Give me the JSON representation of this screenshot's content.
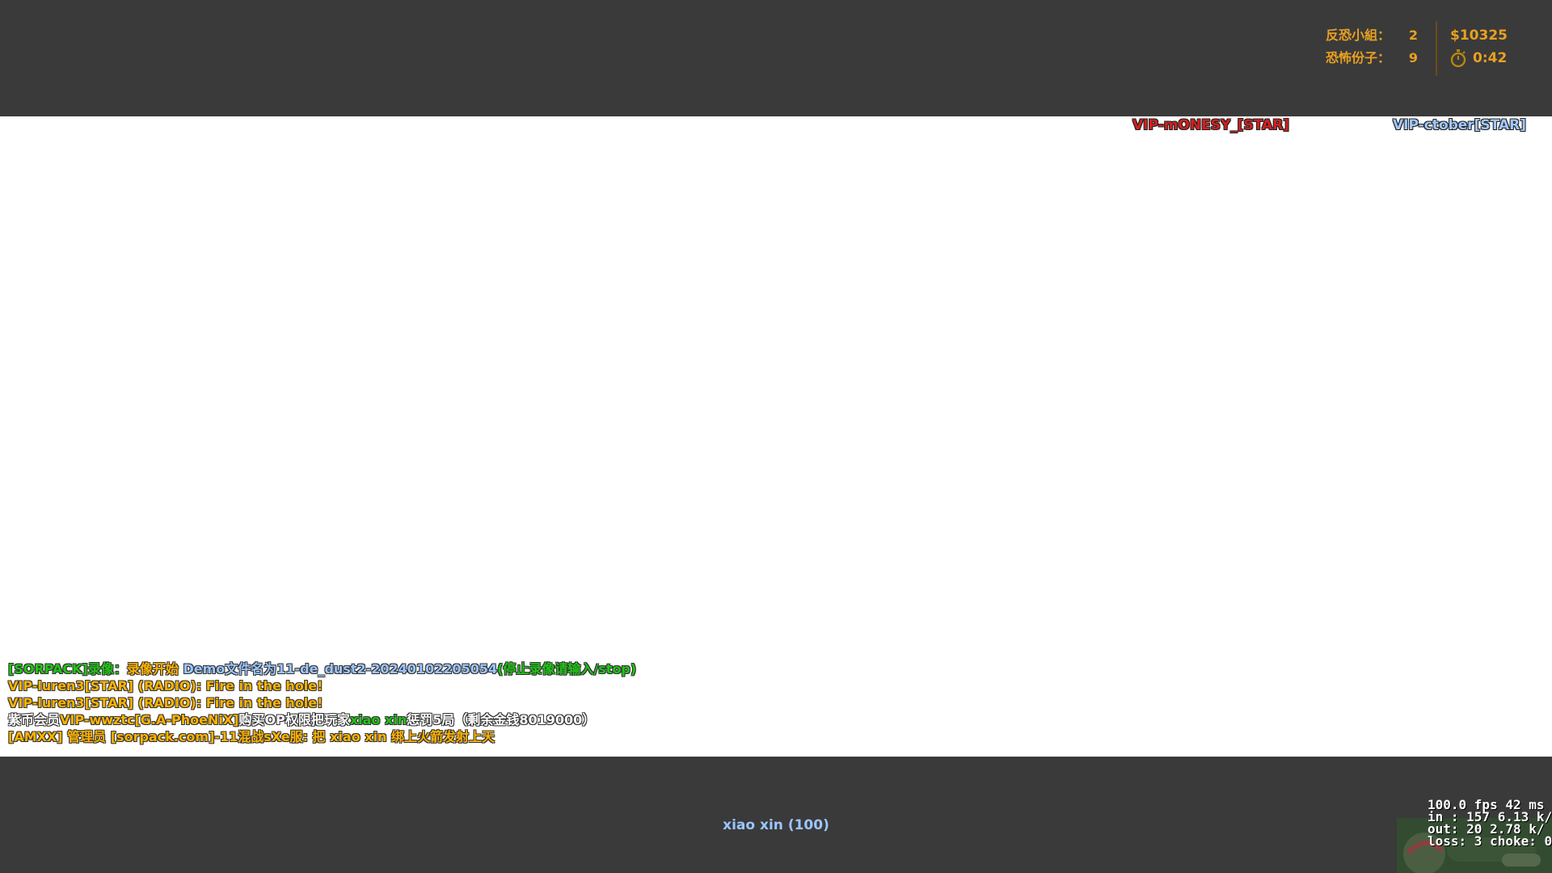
{
  "hud": {
    "ct_label": "反恐小組：",
    "ct_count": "2",
    "t_label": "恐怖份子：",
    "t_count": "9",
    "money": "$10325",
    "timer": "0:42",
    "accent_color": "#e8a020"
  },
  "players": {
    "t_name": "VIP-mONESY_[STAR]",
    "ct_name": "VIP-ctober[STAR]"
  },
  "chat": {
    "line1": {
      "tag": "[SORPACK]录像：",
      "action": "录像开始 ",
      "file": "Demo文件名为11-de_dust2-20240102205054",
      "hint": "(停止录像请输入/stop)"
    },
    "line2": {
      "text": "VIP-luren3[STAR] (RADIO): Fire in the hole!"
    },
    "line3": {
      "text": "VIP-luren3[STAR] (RADIO): Fire in the hole!"
    },
    "line4": {
      "prefix": "紫币会员",
      "player": "VIP-wwztc[G.A-PhoeNiX]",
      "mid": "购买OP权限把玩家",
      "target": "xiao xin",
      "suffix": "惩罚5局（剩余金钱8019000）"
    },
    "line5": {
      "text": "[AMXX] 管理员 [sorpack.com]-11混战sXe服: 把 xiao xin 绑上火箭发射上天"
    }
  },
  "spectator": {
    "target": "xiao xin (100)"
  },
  "netgraph": {
    "row1": "100.0 fps",
    "row1_ping": "42 ms",
    "row2": "in :  157 6.13 k/",
    "row3": "out:  20 2.78 k/",
    "row4": "loss: 3 choke:  0"
  },
  "colors": {
    "bar": "#3a3a3a",
    "t_team": "#d22020",
    "ct_team": "#a0c8ff",
    "chat_green": "#22c418",
    "chat_yellow": "#ffb400"
  }
}
